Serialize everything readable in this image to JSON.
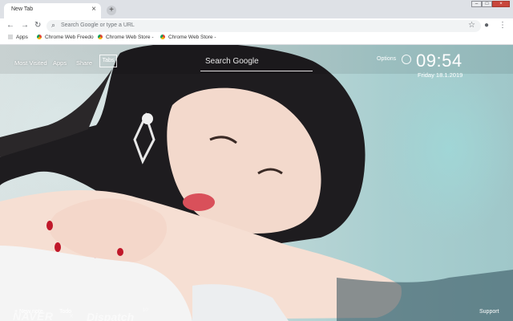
{
  "browser": {
    "tab_title": "New Tab",
    "tab_close": "×",
    "new_tab": "+",
    "window": {
      "minimize": "–",
      "maximize": "□",
      "close": "×"
    },
    "omnibox_placeholder": "Search Google or type a URL"
  },
  "bookmarks": [
    {
      "label": "Apps"
    },
    {
      "label": "Chrome Web Freedo"
    },
    {
      "label": "Chrome Web Store -"
    },
    {
      "label": "Chrome Web Store -"
    }
  ],
  "page": {
    "nav": {
      "most_visited": "Most Visited",
      "apps": "Apps",
      "share": "Share",
      "tabs": "Tabs"
    },
    "search_placeholder": "Search Google",
    "options": "Options",
    "clock": "09:54",
    "date": "Friday  18.1.2019",
    "bottom": {
      "new_note": "+ New note",
      "todo": "Todo",
      "support": "Support"
    },
    "watermark": {
      "left": "NAVER",
      "sep": "×",
      "right": "Dispatch",
      "super": "10"
    }
  },
  "colors": {
    "tabstrip": "#dee1e6",
    "close_red": "#c9473c"
  }
}
